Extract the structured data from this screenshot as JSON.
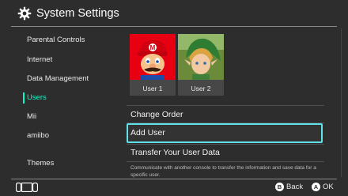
{
  "header": {
    "title": "System Settings",
    "icon": "gear-icon"
  },
  "sidebar": {
    "items": [
      {
        "label": "Parental Controls"
      },
      {
        "label": "Internet"
      },
      {
        "label": "Data Management"
      },
      {
        "label": "Users",
        "active": true
      },
      {
        "label": "Mii"
      },
      {
        "label": "amiibo"
      },
      {
        "label": "Themes"
      }
    ]
  },
  "users": [
    {
      "name": "User 1",
      "avatar": "red-cap-plumber-avatar",
      "bg": "#e60012"
    },
    {
      "name": "User 2",
      "avatar": "green-cap-hero-avatar",
      "bg": "#6b8a3a"
    }
  ],
  "menu": {
    "change_order": "Change Order",
    "add_user": "Add User",
    "transfer": "Transfer Your User Data",
    "transfer_desc": "Communicate with another console to transfer the information and save data for a specific user."
  },
  "footer": {
    "back_button": "B",
    "back_label": "Back",
    "ok_button": "A",
    "ok_label": "OK"
  },
  "colors": {
    "accent": "#00ffc8",
    "focus": "#60e0e8",
    "background": "#2d2d2d"
  }
}
